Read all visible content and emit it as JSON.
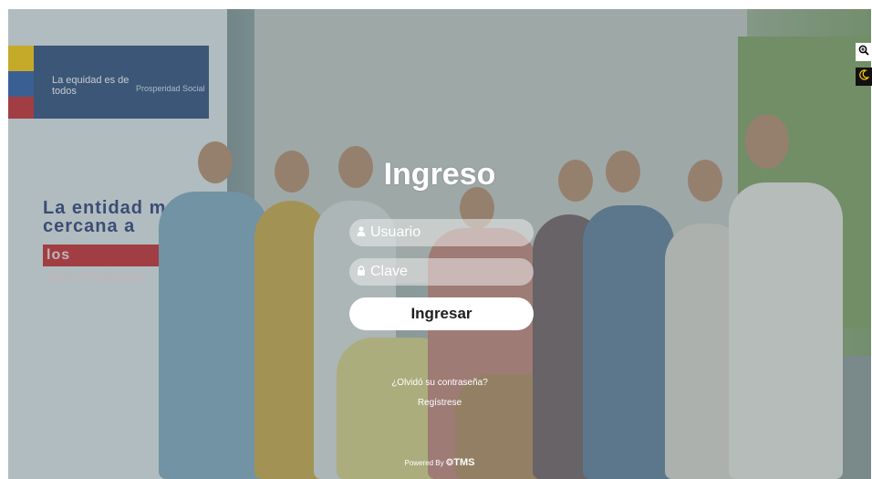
{
  "login": {
    "title": "Ingreso",
    "username_placeholder": "Usuario",
    "password_placeholder": "Clave",
    "submit_label": "Ingresar",
    "forgot_password_link": "¿Olvidó su contraseña?",
    "register_link": "Regístrese",
    "powered_by_prefix": "Powered By",
    "powered_by_brand": "TMS"
  },
  "background": {
    "banner_logo_line": "La equidad es de todos",
    "banner_org": "Prosperidad Social",
    "banner_slogan": "La entidad más cercana a",
    "banner_highlight": "los colombianos"
  },
  "icons": {
    "user": "user-icon",
    "lock": "lock-icon",
    "zoom": "zoom-icon",
    "moon": "moon-icon"
  },
  "colors": {
    "accent": "#ffffff",
    "banner_blue": "#2c4a7c",
    "banner_red": "#c8262d"
  }
}
